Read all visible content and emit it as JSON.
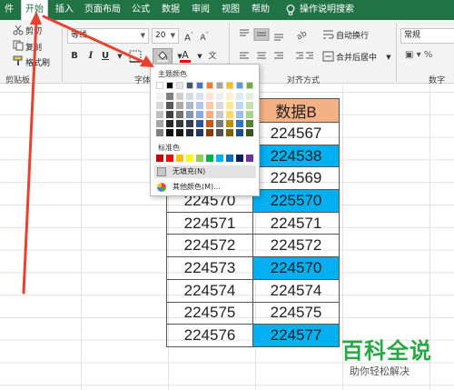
{
  "ribbon_tabs": [
    "件",
    "开始",
    "插入",
    "页面布局",
    "公式",
    "数据",
    "审阅",
    "视图",
    "帮助"
  ],
  "tell_me": "操作说明搜索",
  "clipboard": {
    "cut": "剪切",
    "copy": "复制",
    "format_painter": "格式刷",
    "group": "剪贴板"
  },
  "font": {
    "name": "等线",
    "size": "20",
    "group": "字体"
  },
  "alignment": {
    "wrap_text": "自动换行",
    "merge_center": "合并后居中",
    "group": "对齐方式"
  },
  "number": {
    "format": "常规",
    "group": "数字"
  },
  "fill_menu": {
    "theme_title": "主题颜色",
    "theme_colors": [
      "#ffffff",
      "#000000",
      "#e7e6e6",
      "#44546a",
      "#4472c4",
      "#ed7d31",
      "#a5a5a5",
      "#ffc000",
      "#5b9bd5",
      "#70ad47"
    ],
    "theme_tints": [
      [
        "#f2f2f2",
        "#7f7f7f",
        "#d0cece",
        "#d6dce4",
        "#d9e1f2",
        "#fce4d6",
        "#ededed",
        "#fff2cc",
        "#ddebf7",
        "#e2efda"
      ],
      [
        "#d9d9d9",
        "#595959",
        "#aeaaaa",
        "#acb9ca",
        "#b4c6e7",
        "#f8cbad",
        "#dbdbdb",
        "#ffe699",
        "#bdd7ee",
        "#c6e0b4"
      ],
      [
        "#bfbfbf",
        "#404040",
        "#757171",
        "#8497b0",
        "#8ea9db",
        "#f4b084",
        "#c9c9c9",
        "#ffd966",
        "#9bc2e6",
        "#a9d08e"
      ],
      [
        "#a6a6a6",
        "#262626",
        "#3a3838",
        "#333f4f",
        "#2f5597",
        "#c65911",
        "#7b7b7b",
        "#bf8f00",
        "#2e75b6",
        "#548235"
      ],
      [
        "#808080",
        "#0d0d0d",
        "#161616",
        "#222b35",
        "#1f3864",
        "#833c0c",
        "#525252",
        "#806000",
        "#1f4e78",
        "#375623"
      ]
    ],
    "standard_title": "标准色",
    "standard_colors": [
      "#c00000",
      "#ff0000",
      "#ffc000",
      "#ffff00",
      "#92d050",
      "#00b050",
      "#00b0f0",
      "#0070c0",
      "#002060",
      "#7030a0"
    ],
    "no_fill": "无填充(N)",
    "more_colors": "其他颜色(M)..."
  },
  "table": {
    "header_b": "数据B",
    "rows": [
      {
        "a": "",
        "b": "224567",
        "b_color": "white"
      },
      {
        "a": "",
        "b": "224538",
        "b_color": "blue"
      },
      {
        "a": "",
        "b": "224569",
        "b_color": "white"
      },
      {
        "a": "224570",
        "b": "225570",
        "b_color": "blue"
      },
      {
        "a": "224571",
        "b": "224571",
        "b_color": "white"
      },
      {
        "a": "224572",
        "b": "224572",
        "b_color": "white"
      },
      {
        "a": "224573",
        "b": "224570",
        "b_color": "blue"
      },
      {
        "a": "224574",
        "b": "224574",
        "b_color": "white"
      },
      {
        "a": "224575",
        "b": "224575",
        "b_color": "white"
      },
      {
        "a": "224576",
        "b": "224577",
        "b_color": "blue"
      }
    ]
  },
  "colors": {
    "accent_green": "#217346",
    "header_fill": "#f4b183",
    "highlight_blue": "#00b0f0",
    "arrow_red": "#e8412f"
  },
  "watermark": {
    "title": "百科全说",
    "subtitle": "助你轻松解决"
  }
}
